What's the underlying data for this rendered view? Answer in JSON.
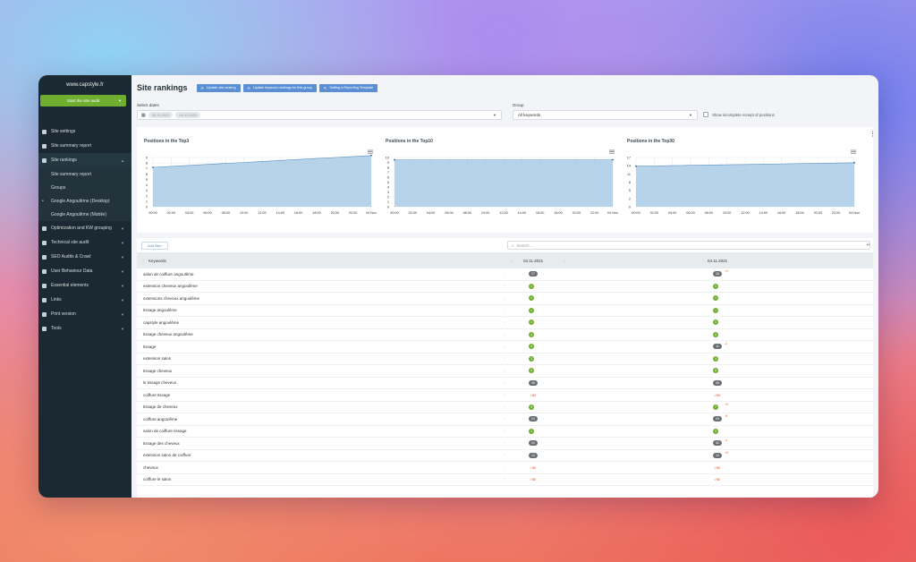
{
  "sidebar": {
    "domain": "www.capstyle.fr",
    "audit_button": "Start the site audit",
    "items": [
      {
        "label": "Site settings"
      },
      {
        "label": "Site summary report"
      },
      {
        "label": "Site rankings"
      },
      {
        "label": "Site summary report"
      },
      {
        "label": "Groups"
      },
      {
        "label": "Google Angoulême (Desktop)"
      },
      {
        "label": "Google Angoulême (Mobile)"
      },
      {
        "label": "Optimization and KW grouping"
      },
      {
        "label": "Technical site audit"
      },
      {
        "label": "SEO Audits & Crawl"
      },
      {
        "label": "User Behaviour Data"
      },
      {
        "label": "Essential elements"
      },
      {
        "label": "Links"
      },
      {
        "label": "Print version"
      },
      {
        "label": "Tools"
      }
    ]
  },
  "header": {
    "title": "Site rankings",
    "buttons": [
      "Update site ranking",
      "Update keyword rankings for this group",
      "Setting a Reporting Template"
    ]
  },
  "filters": {
    "dates_label": "Select dates",
    "date_from": "03.11.2021",
    "date_to": "04.11.2021",
    "group_label": "Group",
    "group_value": "All keywords",
    "incomplete_label": "Show incomplete receipt of positions"
  },
  "charts": [
    {
      "title": "Positions in the Top3",
      "yticks": [
        "9",
        "8",
        "7",
        "6",
        "5",
        "4",
        "3",
        "2",
        "1",
        "0"
      ]
    },
    {
      "title": "Positions in the Top10",
      "yticks": [
        "10",
        "9",
        "8",
        "7",
        "6",
        "5",
        "4",
        "3",
        "2",
        "1",
        "0"
      ]
    },
    {
      "title": "Positions in the Top30",
      "yticks": [
        "17",
        "14",
        "11",
        "8",
        "5",
        "2",
        "0"
      ]
    }
  ],
  "chart_data": [
    {
      "type": "area",
      "title": "Positions in the Top3",
      "x": [
        "00:00",
        "02:00",
        "04:00",
        "06:00",
        "08:00",
        "10:00",
        "12:00",
        "14:00",
        "16:00",
        "18:00",
        "20:00",
        "22:00",
        "04 Nov"
      ],
      "series": [
        {
          "values": [
            8,
            8.2,
            8.4,
            8.6,
            8.8,
            9,
            9.2,
            9.4,
            9.6,
            9.8,
            10,
            10.2,
            10.4
          ]
        }
      ],
      "ylim": [
        0,
        10
      ]
    },
    {
      "type": "area",
      "title": "Positions in the Top10",
      "x": [
        "00:00",
        "02:00",
        "04:00",
        "06:00",
        "08:00",
        "10:00",
        "12:00",
        "14:00",
        "16:00",
        "18:00",
        "20:00",
        "22:00",
        "04 Nov"
      ],
      "series": [
        {
          "values": [
            10,
            10,
            10,
            10,
            10,
            10,
            10,
            10,
            10,
            10,
            10,
            10,
            10
          ]
        }
      ],
      "ylim": [
        0,
        10.5
      ]
    },
    {
      "type": "area",
      "title": "Positions in the Top30",
      "x": [
        "00:00",
        "02:00",
        "04:00",
        "06:00",
        "08:00",
        "10:00",
        "12:00",
        "14:00",
        "16:00",
        "18:00",
        "20:00",
        "22:00",
        "04 Nov"
      ],
      "series": [
        {
          "values": [
            14,
            14.1,
            14.2,
            14.3,
            14.4,
            14.5,
            14.6,
            14.7,
            14.8,
            14.9,
            15,
            15.1,
            15.2
          ]
        }
      ],
      "ylim": [
        0,
        17
      ]
    }
  ],
  "table": {
    "add_filter": "Add filter",
    "search_placeholder": "Search...",
    "col_keyword": "Keywords",
    "col_date1": "03.11.2021",
    "col_date2": "04.11.2021",
    "rows": [
      {
        "kw": "salon de coiffure angoulême",
        "v1": "27",
        "t1": "gray",
        "v2": "26",
        "t2": "gray",
        "d": "+1"
      },
      {
        "kw": "extension cheveux angoulême",
        "v1": "1",
        "t1": "green",
        "v2": "1",
        "t2": "green",
        "d": ""
      },
      {
        "kw": "extensions cheveux angoulême",
        "v1": "1",
        "t1": "green",
        "v2": "1",
        "t2": "green",
        "d": ""
      },
      {
        "kw": "tissage angoulême",
        "v1": "1",
        "t1": "green",
        "v2": "1",
        "t2": "green",
        "d": ""
      },
      {
        "kw": "capstyle angoulême",
        "v1": "1",
        "t1": "green",
        "v2": "1",
        "t2": "green",
        "d": ""
      },
      {
        "kw": "tissage cheveux angoulême",
        "v1": "4",
        "t1": "green",
        "v2": "4",
        "t2": "green",
        "d": ""
      },
      {
        "kw": "tissage",
        "v1": "9",
        "t1": "green",
        "v2": "11",
        "t2": "gray",
        "d": "-2"
      },
      {
        "kw": "extension salon",
        "v1": "3",
        "t1": "green",
        "v2": "3",
        "t2": "green",
        "d": ""
      },
      {
        "kw": "tissage cheveux",
        "v1": "5",
        "t1": "green",
        "v2": "5",
        "t2": "green",
        "d": ""
      },
      {
        "kw": "le tissage cheveux",
        "v1": "45",
        "t1": "gray",
        "v2": "45",
        "t2": "gray",
        "d": ""
      },
      {
        "kw": "coiffure tissage",
        "v1": ">50",
        "t1": "red",
        "v2": ">50",
        "t2": "red",
        "d": ""
      },
      {
        "kw": "tissage de cheveux",
        "v1": "9",
        "t1": "green",
        "v2": "7",
        "t2": "green",
        "d": "+2"
      },
      {
        "kw": "coiffure angoulême",
        "v1": "24",
        "t1": "gray",
        "v2": "29",
        "t2": "gray",
        "d": "-5"
      },
      {
        "kw": "salon de coiffure tissage",
        "v1": "1",
        "t1": "green",
        "v2": "1",
        "t2": "green",
        "d": ""
      },
      {
        "kw": "tissage des cheveux",
        "v1": "41",
        "t1": "gray",
        "v2": "42",
        "t2": "gray",
        "d": "-1"
      },
      {
        "kw": "extension salon de coiffure",
        "v1": "14",
        "t1": "gray",
        "v2": "12",
        "t2": "gray",
        "d": "+2"
      },
      {
        "kw": "cheveux",
        "v1": ">50",
        "t1": "red",
        "v2": ">50",
        "t2": "red",
        "d": ""
      },
      {
        "kw": "coiffure le salon",
        "v1": ">50",
        "t1": "red",
        "v2": ">50",
        "t2": "red",
        "d": ""
      }
    ]
  },
  "colors": {
    "sidebar_bg": "#1b2a32",
    "accent_green": "#6fae2f",
    "button_blue": "#5b8fd4",
    "chart_fill": "#a9cbe6",
    "chart_line": "#5b8fc4"
  }
}
